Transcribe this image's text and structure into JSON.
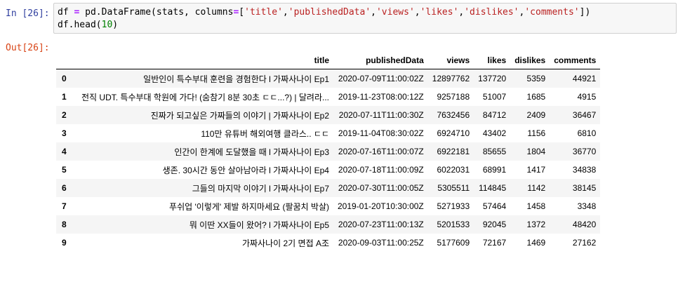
{
  "input_prompt": "In [26]:",
  "output_prompt": "Out[26]:",
  "code": {
    "line1": {
      "t1": "df ",
      "t2": "=",
      "t3": " pd.DataFrame(stats, columns",
      "t4": "=",
      "t5": "[",
      "s1": "'title'",
      "c1": ",",
      "s2": "'publishedData'",
      "c2": ",",
      "s3": "'views'",
      "c3": ",",
      "s4": "'likes'",
      "c4": ",",
      "s5": "'dislikes'",
      "c5": ",",
      "s6": "'comments'",
      "t6": "])"
    },
    "line2": {
      "t1": "df.head(",
      "n1": "10",
      "t2": ")"
    }
  },
  "table": {
    "columns": [
      "",
      "title",
      "publishedData",
      "views",
      "likes",
      "dislikes",
      "comments"
    ],
    "rows": [
      {
        "index": "0",
        "title": "일반인이 특수부대 훈련을 경험한다 l 가짜사나이 Ep1",
        "publishedData": "2020-07-09T11:00:02Z",
        "views": "12897762",
        "likes": "137720",
        "dislikes": "5359",
        "comments": "44921"
      },
      {
        "index": "1",
        "title": "전직 UDT. 특수부대 학원에 가다! (숨참기 8분 30초 ㄷㄷ...?) | 달려라...",
        "publishedData": "2019-11-23T08:00:12Z",
        "views": "9257188",
        "likes": "51007",
        "dislikes": "1685",
        "comments": "4915"
      },
      {
        "index": "2",
        "title": "진짜가 되고싶은 가짜들의 이야기 | 가짜사나이 Ep2",
        "publishedData": "2020-07-11T11:00:30Z",
        "views": "7632456",
        "likes": "84712",
        "dislikes": "2409",
        "comments": "36467"
      },
      {
        "index": "3",
        "title": "110만 유튜버 해외여행 클라스.. ㄷㄷ",
        "publishedData": "2019-11-04T08:30:02Z",
        "views": "6924710",
        "likes": "43402",
        "dislikes": "1156",
        "comments": "6810"
      },
      {
        "index": "4",
        "title": "인간이 한계에 도달했을 때 l 가짜사나이 Ep3",
        "publishedData": "2020-07-16T11:00:07Z",
        "views": "6922181",
        "likes": "85655",
        "dislikes": "1804",
        "comments": "36770"
      },
      {
        "index": "5",
        "title": "생존. 30시간 동안 살아남아라 l 가짜사나이 Ep4",
        "publishedData": "2020-07-18T11:00:09Z",
        "views": "6022031",
        "likes": "68991",
        "dislikes": "1417",
        "comments": "34838"
      },
      {
        "index": "6",
        "title": "그들의 마지막 이야기 l 가짜사나이 Ep7",
        "publishedData": "2020-07-30T11:00:05Z",
        "views": "5305511",
        "likes": "114845",
        "dislikes": "1142",
        "comments": "38145"
      },
      {
        "index": "7",
        "title": "푸쉬업 '이렇게' 제발 하지마세요 (팔꿈치 박살)",
        "publishedData": "2019-01-20T10:30:00Z",
        "views": "5271933",
        "likes": "57464",
        "dislikes": "1458",
        "comments": "3348"
      },
      {
        "index": "8",
        "title": "뭐 이딴 XX들이 왔어? l 가짜사나이 Ep5",
        "publishedData": "2020-07-23T11:00:13Z",
        "views": "5201533",
        "likes": "92045",
        "dislikes": "1372",
        "comments": "48420"
      },
      {
        "index": "9",
        "title": "가짜사나이 2기 면접 A조",
        "publishedData": "2020-09-03T11:00:25Z",
        "views": "5177609",
        "likes": "72167",
        "dislikes": "1469",
        "comments": "27162"
      }
    ]
  },
  "colors": {
    "in_prompt": "#303f9f",
    "out_prompt": "#d84315",
    "string": "#ba2121",
    "number": "#008000",
    "operator": "#aa22ff",
    "stripe": "#f5f5f5"
  }
}
